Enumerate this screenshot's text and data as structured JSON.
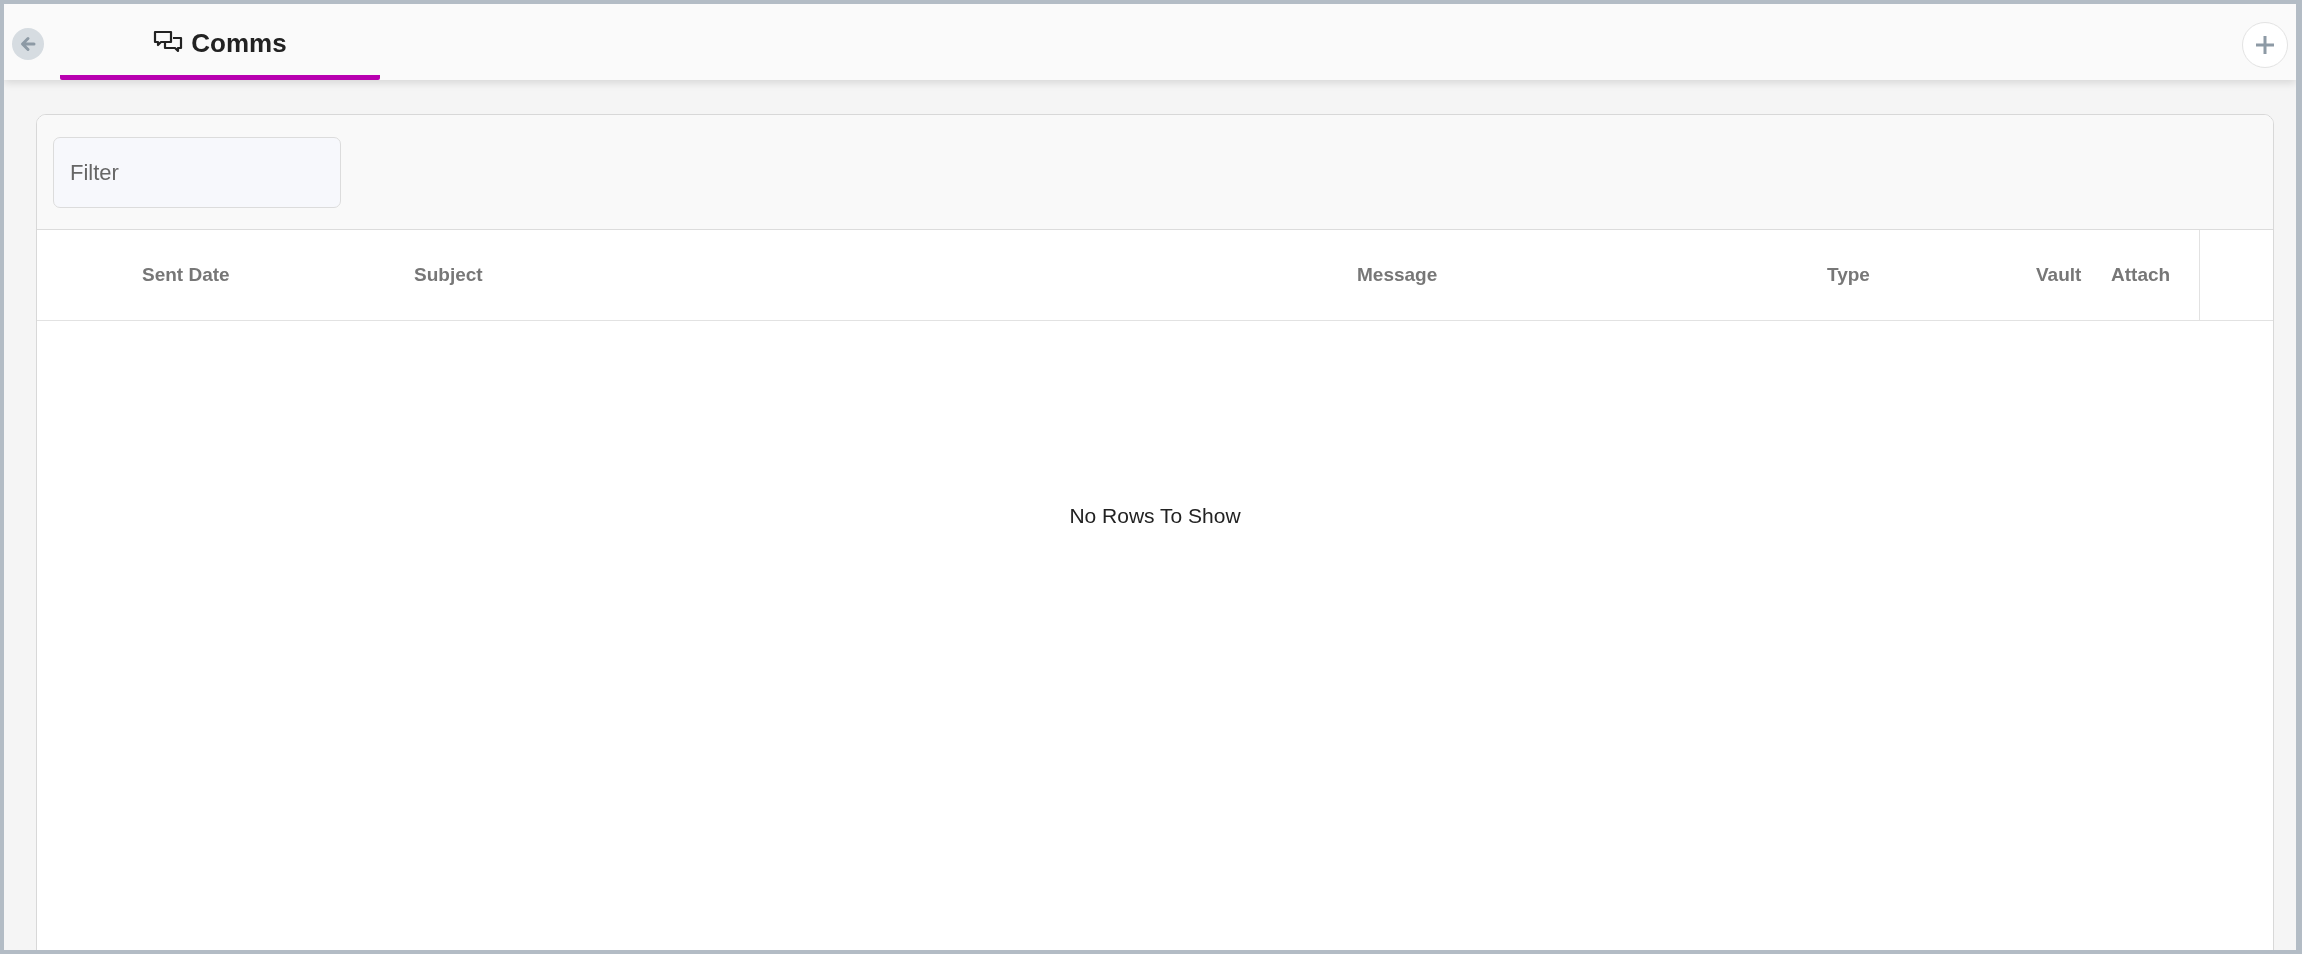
{
  "tabs": [
    {
      "label": "Comms",
      "selected": true
    }
  ],
  "filter": {
    "placeholder": "Filter"
  },
  "table": {
    "columns": [
      "Sent Date",
      "Subject",
      "Message",
      "Type",
      "Vault",
      "Attach"
    ],
    "empty_message": "No Rows To Show"
  }
}
